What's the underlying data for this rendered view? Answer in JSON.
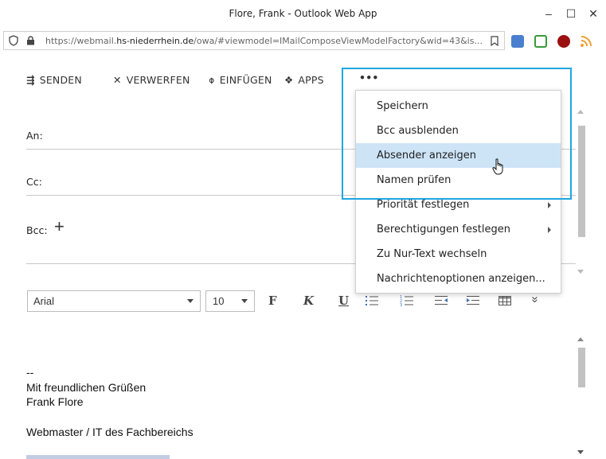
{
  "window": {
    "title": "Flore, Frank - Outlook Web App",
    "minimize": "–",
    "maximize": "☐",
    "close": "✕"
  },
  "address": {
    "url_prefix": "https://webmail.",
    "url_host": "hs-niederrhein.de",
    "url_rest": "/owa/#viewmodel=IMailComposeViewModelFactory&wid=43&is..."
  },
  "toolbar": {
    "send": "SENDEN",
    "discard": "VERWERFEN",
    "insert": "EINFÜGEN",
    "apps": "APPS",
    "more": "•••"
  },
  "fields": {
    "to": "An:",
    "cc": "Cc:",
    "bcc": "Bcc:",
    "bcc_add": "+"
  },
  "format": {
    "font": "Arial",
    "size": "10",
    "bold": "F",
    "italic": "K",
    "underline": "U",
    "more": "»"
  },
  "body": {
    "line1": "--",
    "line2": "Mit freundlichen Grüßen",
    "line3": "Frank Flore",
    "line4": "Webmaster / IT des Fachbereichs"
  },
  "menu": {
    "items": [
      {
        "label": "Speichern"
      },
      {
        "label": "Bcc ausblenden"
      },
      {
        "label": "Absender anzeigen"
      },
      {
        "label": "Namen prüfen"
      },
      {
        "label": "Priorität festlegen"
      },
      {
        "label": "Berechtigungen festlegen"
      },
      {
        "label": "Zu Nur-Text wechseln"
      },
      {
        "label": "Nachrichtenoptionen anzeigen..."
      }
    ]
  },
  "colors": {
    "highlight_box": "#1ea7e1",
    "menu_hover": "#cde4f7"
  }
}
